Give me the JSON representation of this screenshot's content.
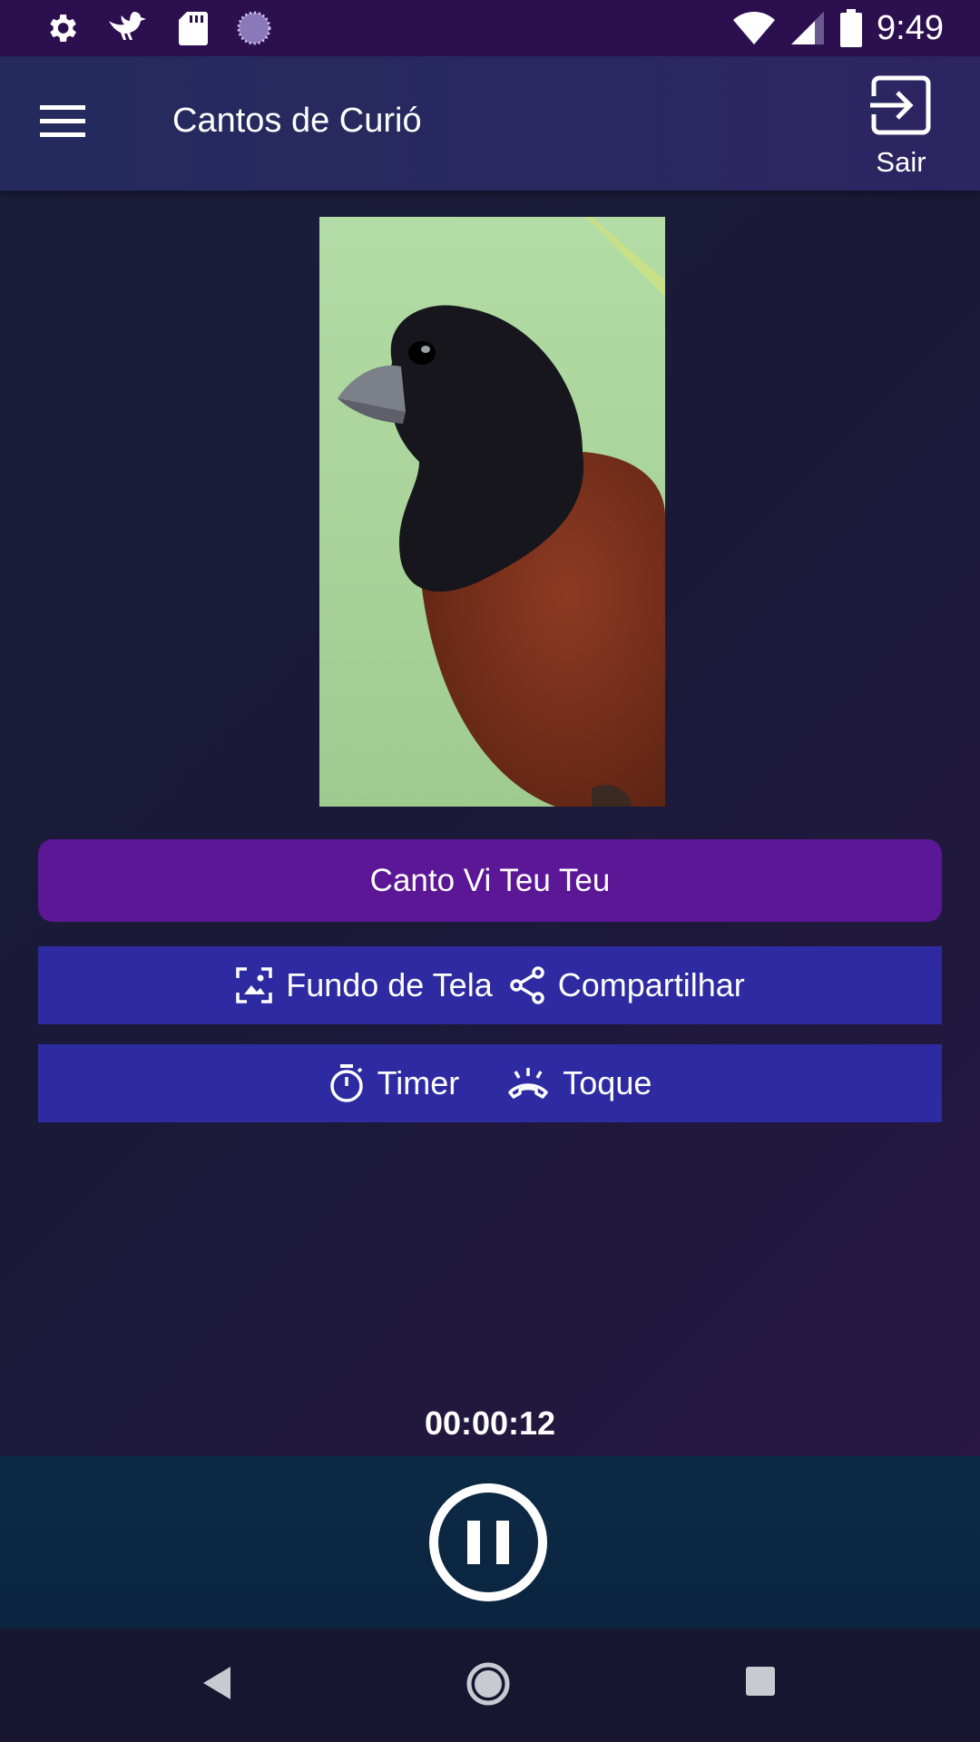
{
  "status": {
    "time": "9:49"
  },
  "appbar": {
    "title": "Cantos de Curió",
    "exit_label": "Sair"
  },
  "song": {
    "title": "Canto Vi Teu Teu"
  },
  "actions": {
    "wallpaper_label": "Fundo de Tela",
    "share_label": "Compartilhar",
    "timer_label": "Timer",
    "ringtone_label": "Toque"
  },
  "player": {
    "elapsed": "00:00:12"
  },
  "icons": {
    "status": [
      "gear-icon",
      "bird-icon",
      "sd-card-icon",
      "loading-icon",
      "wifi-icon",
      "signal-icon",
      "battery-icon"
    ],
    "appbar": [
      "menu-icon",
      "exit-icon"
    ],
    "actions": [
      "wallpaper-icon",
      "share-icon",
      "stopwatch-icon",
      "ringtone-icon"
    ],
    "player": [
      "pause-icon"
    ],
    "nav": [
      "back-icon",
      "home-icon",
      "recents-icon"
    ]
  },
  "colors": {
    "accent_purple": "#5b1796",
    "action_blue": "#2d2aa2",
    "status_bar": "#2c0f4f",
    "player_bg": "#0c2a45"
  }
}
